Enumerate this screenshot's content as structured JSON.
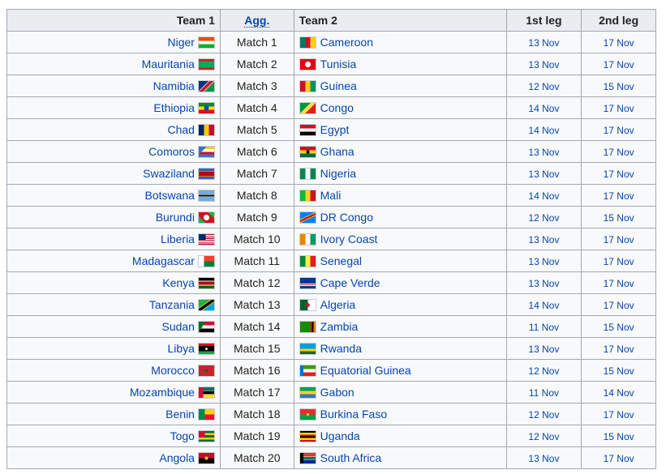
{
  "header": {
    "team1": "Team 1",
    "agg": "Agg.",
    "team2": "Team 2",
    "leg1": "1st leg",
    "leg2": "2nd leg"
  },
  "rows": [
    {
      "team1": "Niger",
      "flag1": "niger-flag-icon",
      "match": "Match 1",
      "team2": "Cameroon",
      "flag2": "cameroon-flag-icon",
      "leg1": "13 Nov",
      "leg2": "17 Nov"
    },
    {
      "team1": "Mauritania",
      "flag1": "mauritania-flag-icon",
      "match": "Match 2",
      "team2": "Tunisia",
      "flag2": "tunisia-flag-icon",
      "leg1": "13 Nov",
      "leg2": "17 Nov"
    },
    {
      "team1": "Namibia",
      "flag1": "namibia-flag-icon",
      "match": "Match 3",
      "team2": "Guinea",
      "flag2": "guinea-flag-icon",
      "leg1": "12 Nov",
      "leg2": "15 Nov"
    },
    {
      "team1": "Ethiopia",
      "flag1": "ethiopia-flag-icon",
      "match": "Match 4",
      "team2": "Congo",
      "flag2": "congo-flag-icon",
      "leg1": "14 Nov",
      "leg2": "17 Nov"
    },
    {
      "team1": "Chad",
      "flag1": "chad-flag-icon",
      "match": "Match 5",
      "team2": "Egypt",
      "flag2": "egypt-flag-icon",
      "leg1": "14 Nov",
      "leg2": "17 Nov"
    },
    {
      "team1": "Comoros",
      "flag1": "comoros-flag-icon",
      "match": "Match 6",
      "team2": "Ghana",
      "flag2": "ghana-flag-icon",
      "leg1": "13 Nov",
      "leg2": "17 Nov"
    },
    {
      "team1": "Swaziland",
      "flag1": "swaziland-flag-icon",
      "match": "Match 7",
      "team2": "Nigeria",
      "flag2": "nigeria-flag-icon",
      "leg1": "13 Nov",
      "leg2": "17 Nov"
    },
    {
      "team1": "Botswana",
      "flag1": "botswana-flag-icon",
      "match": "Match 8",
      "team2": "Mali",
      "flag2": "mali-flag-icon",
      "leg1": "14 Nov",
      "leg2": "17 Nov"
    },
    {
      "team1": "Burundi",
      "flag1": "burundi-flag-icon",
      "match": "Match 9",
      "team2": "DR Congo",
      "flag2": "dr-congo-flag-icon",
      "leg1": "12 Nov",
      "leg2": "15 Nov"
    },
    {
      "team1": "Liberia",
      "flag1": "liberia-flag-icon",
      "match": "Match 10",
      "team2": "Ivory Coast",
      "flag2": "ivory-coast-flag-icon",
      "leg1": "13 Nov",
      "leg2": "17 Nov"
    },
    {
      "team1": "Madagascar",
      "flag1": "madagascar-flag-icon",
      "match": "Match 11",
      "team2": "Senegal",
      "flag2": "senegal-flag-icon",
      "leg1": "13 Nov",
      "leg2": "17 Nov"
    },
    {
      "team1": "Kenya",
      "flag1": "kenya-flag-icon",
      "match": "Match 12",
      "team2": "Cape Verde",
      "flag2": "cape-verde-flag-icon",
      "leg1": "13 Nov",
      "leg2": "17 Nov"
    },
    {
      "team1": "Tanzania",
      "flag1": "tanzania-flag-icon",
      "match": "Match 13",
      "team2": "Algeria",
      "flag2": "algeria-flag-icon",
      "leg1": "14 Nov",
      "leg2": "17 Nov"
    },
    {
      "team1": "Sudan",
      "flag1": "sudan-flag-icon",
      "match": "Match 14",
      "team2": "Zambia",
      "flag2": "zambia-flag-icon",
      "leg1": "11 Nov",
      "leg2": "15 Nov"
    },
    {
      "team1": "Libya",
      "flag1": "libya-flag-icon",
      "match": "Match 15",
      "team2": "Rwanda",
      "flag2": "rwanda-flag-icon",
      "leg1": "13 Nov",
      "leg2": "17 Nov"
    },
    {
      "team1": "Morocco",
      "flag1": "morocco-flag-icon",
      "match": "Match 16",
      "team2": "Equatorial Guinea",
      "flag2": "equatorial-guinea-flag-icon",
      "leg1": "12 Nov",
      "leg2": "15 Nov"
    },
    {
      "team1": "Mozambique",
      "flag1": "mozambique-flag-icon",
      "match": "Match 17",
      "team2": "Gabon",
      "flag2": "gabon-flag-icon",
      "leg1": "11 Nov",
      "leg2": "14 Nov"
    },
    {
      "team1": "Benin",
      "flag1": "benin-flag-icon",
      "match": "Match 18",
      "team2": "Burkina Faso",
      "flag2": "burkina-faso-flag-icon",
      "leg1": "12 Nov",
      "leg2": "17 Nov"
    },
    {
      "team1": "Togo",
      "flag1": "togo-flag-icon",
      "match": "Match 19",
      "team2": "Uganda",
      "flag2": "uganda-flag-icon",
      "leg1": "12 Nov",
      "leg2": "15 Nov"
    },
    {
      "team1": "Angola",
      "flag1": "angola-flag-icon",
      "match": "Match 20",
      "team2": "South Africa",
      "flag2": "south-africa-flag-icon",
      "leg1": "13 Nov",
      "leg2": "17 Nov"
    }
  ],
  "colors": {
    "link": "#0645ad",
    "header_bg": "#eaecf0",
    "cell_bg": "#f8f9fa",
    "border": "#a2a9b1"
  }
}
